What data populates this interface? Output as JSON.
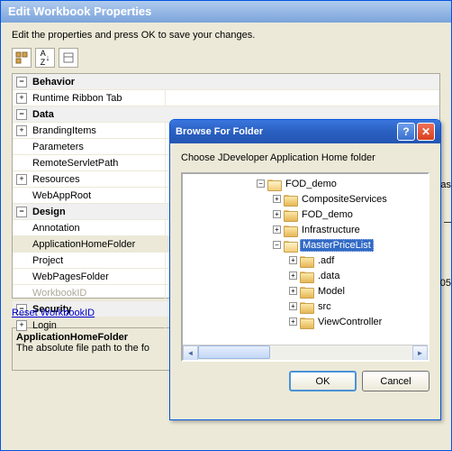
{
  "outer": {
    "title": "Edit Workbook Properties",
    "hint": "Edit the properties and press OK to save your changes."
  },
  "toolbar": {
    "icons": [
      "categorized",
      "alphabetical",
      "property-pages"
    ]
  },
  "props": {
    "cat_behavior": "Behavior",
    "runtime_ribbon": "Runtime Ribbon Tab",
    "cat_data": "Data",
    "branding": "BrandingItems",
    "parameters": "Parameters",
    "remote": "RemoteServletPath",
    "resources": "Resources",
    "webapproot": "WebAppRoot",
    "cat_design": "Design",
    "annotation": "Annotation",
    "apphome": "ApplicationHomeFolder",
    "project": "Project",
    "webpages": "WebPagesFolder",
    "workbookid": "WorkbookID",
    "cat_security": "Security",
    "login": "Login"
  },
  "reset_link": "Reset WorkbookID",
  "desc": {
    "title": "ApplicationHomeFolder",
    "text": "The absolute file path to the fo"
  },
  "dialog": {
    "title": "Browse For Folder",
    "hint": "Choose JDeveloper Application Home folder",
    "ok": "OK",
    "cancel": "Cancel"
  },
  "tree": {
    "root": "FOD_demo",
    "items": [
      {
        "label": "CompositeServices",
        "depth": 1,
        "toggle": "+"
      },
      {
        "label": "FOD_demo",
        "depth": 1,
        "toggle": "+"
      },
      {
        "label": "Infrastructure",
        "depth": 1,
        "toggle": "+"
      },
      {
        "label": "MasterPriceList",
        "depth": 1,
        "toggle": "-",
        "selected": true
      },
      {
        "label": ".adf",
        "depth": 2,
        "toggle": "+"
      },
      {
        "label": ".data",
        "depth": 2,
        "toggle": "+"
      },
      {
        "label": "Model",
        "depth": 2,
        "toggle": "+"
      },
      {
        "label": "src",
        "depth": 2,
        "toggle": "+"
      },
      {
        "label": "ViewController",
        "depth": 2,
        "toggle": "+"
      }
    ]
  },
  "edge": {
    "as": "as",
    "num": "05"
  }
}
